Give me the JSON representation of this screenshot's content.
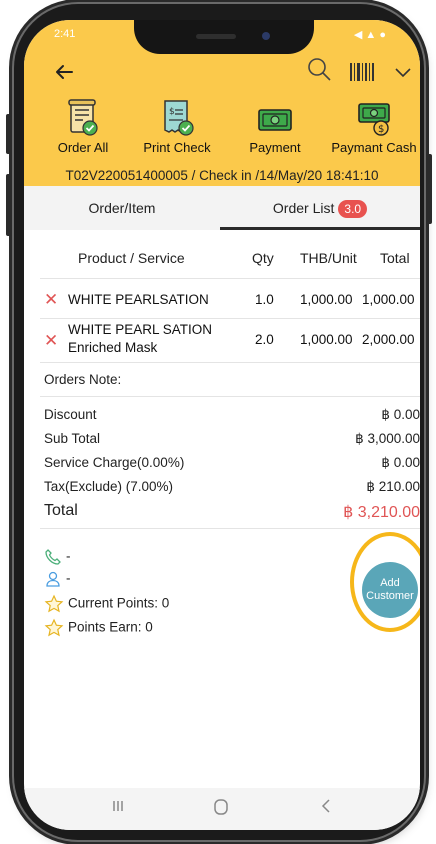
{
  "status_bar": {
    "time": "2:41",
    "icons": "◀ ▲ ●"
  },
  "header": {
    "toolbar": [
      {
        "label": "Order All",
        "icon": "scroll-check-icon"
      },
      {
        "label": "Print Check",
        "icon": "receipt-check-icon"
      },
      {
        "label": "Payment",
        "icon": "cash-icon"
      },
      {
        "label": "Paymant Cash",
        "icon": "cash-coin-icon"
      }
    ],
    "checkin_text": "T02V220051400005 / Check in /14/May/20 18:41:10"
  },
  "tabs": [
    {
      "label": "Order/Item",
      "active": false
    },
    {
      "label": "Order List",
      "active": true,
      "badge": "3.0"
    }
  ],
  "table": {
    "columns": [
      "Product / Service",
      "Qty",
      "THB/Unit",
      "Total"
    ],
    "rows": [
      {
        "name_line1": "WHITE PEARLSATION",
        "name_line2": "",
        "qty": "1.0",
        "unit": "1,000.00",
        "total": "1,000.00"
      },
      {
        "name_line1": "WHITE PEARL SATION",
        "name_line2": "Enriched  Mask",
        "qty": "2.0",
        "unit": "1,000.00",
        "total": "2,000.00"
      }
    ]
  },
  "orders_note_label": "Orders Note:",
  "summary": [
    {
      "label": "Discount",
      "value": "฿ 0.00"
    },
    {
      "label": "Sub Total",
      "value": "฿ 3,000.00"
    },
    {
      "label": "Service Charge(0.00%)",
      "value": "฿ 0.00"
    },
    {
      "label": "Tax(Exclude) (7.00%)",
      "value": "฿ 210.00"
    }
  ],
  "total": {
    "label": "Total",
    "value": "฿ 3,210.00"
  },
  "customer": {
    "phone": "-",
    "name": "-",
    "current_points": "Current Points: 0",
    "points_earn": "Points Earn: 0"
  },
  "add_customer": {
    "line1": "Add",
    "line2": "Customer"
  },
  "colors": {
    "header_bg": "#fbc94b",
    "accent_red": "#e05555",
    "fab_teal": "#5aa6b8",
    "highlight": "#f6b71a"
  }
}
